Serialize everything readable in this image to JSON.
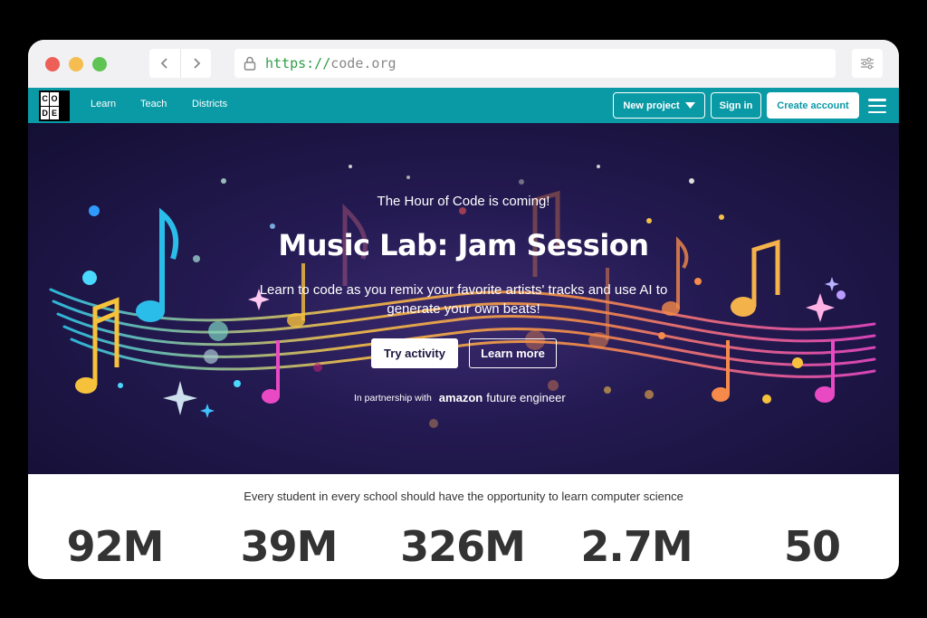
{
  "browser": {
    "url_scheme": "https://",
    "url_host": "code.org"
  },
  "header": {
    "logo_letters": [
      "C",
      "O",
      "D",
      "E"
    ],
    "nav": [
      "Learn",
      "Teach",
      "Districts"
    ],
    "new_project_label": "New project",
    "sign_in_label": "Sign in",
    "create_account_label": "Create account"
  },
  "hero": {
    "kicker": "The Hour of Code is coming!",
    "title": "Music Lab: Jam Session",
    "description": "Learn to code as you remix your favorite artists' tracks and use AI to generate your own beats!",
    "try_label": "Try activity",
    "learn_more_label": "Learn more",
    "partner_prefix": "In partnership with",
    "partner_brand": "amazon",
    "partner_program": "future engineer"
  },
  "stats": {
    "mission": "Every student in every school should have the opportunity to learn computer science",
    "values": [
      "92M",
      "39M",
      "326M",
      "2.7M",
      "50"
    ]
  },
  "colors": {
    "brand_teal": "#0a9aa6",
    "hero_dark": "#140f33"
  }
}
